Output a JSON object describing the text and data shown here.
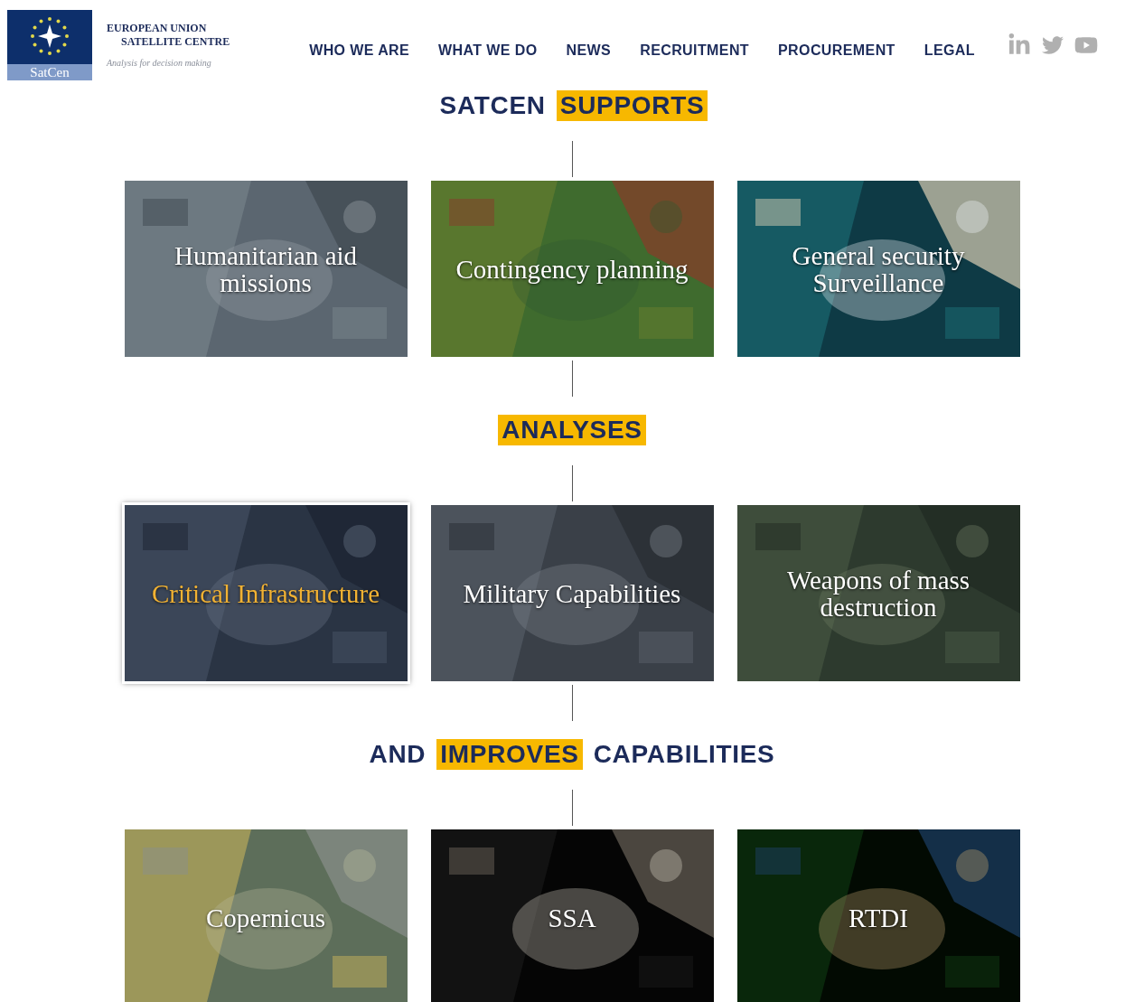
{
  "logo": {
    "badge": "SatCen",
    "name_line_1": "EUROPEAN UNION",
    "name_line_2": "SATELLITE CENTRE",
    "tagline": "Analysis for decision making"
  },
  "nav": [
    {
      "label": "WHO WE ARE"
    },
    {
      "label": "WHAT WE DO"
    },
    {
      "label": "NEWS"
    },
    {
      "label": "RECRUITMENT"
    },
    {
      "label": "PROCUREMENT"
    },
    {
      "label": "LEGAL"
    }
  ],
  "sections": [
    {
      "heading": [
        {
          "text": "SATCEN",
          "highlight": false
        },
        {
          "text": "SUPPORTS",
          "highlight": true
        }
      ],
      "tiles": [
        {
          "title": "Humanitarian aid missions",
          "selected": false
        },
        {
          "title": "Contingency planning",
          "selected": false
        },
        {
          "title": "General security Surveillance",
          "selected": false
        }
      ]
    },
    {
      "heading": [
        {
          "text": "ANALYSES",
          "highlight": true
        }
      ],
      "tiles": [
        {
          "title": "Critical Infrastructure",
          "selected": true
        },
        {
          "title": "Military Capabilities",
          "selected": false
        },
        {
          "title": "Weapons of mass destruction",
          "selected": false
        }
      ]
    },
    {
      "heading": [
        {
          "text": "AND",
          "highlight": false
        },
        {
          "text": "IMPROVES",
          "highlight": true
        },
        {
          "text": "CAPABILITIES",
          "highlight": false
        }
      ],
      "tiles": [
        {
          "title": "Copernicus",
          "selected": false
        },
        {
          "title": "SSA",
          "selected": false
        },
        {
          "title": "RTDI",
          "selected": false
        }
      ]
    }
  ]
}
